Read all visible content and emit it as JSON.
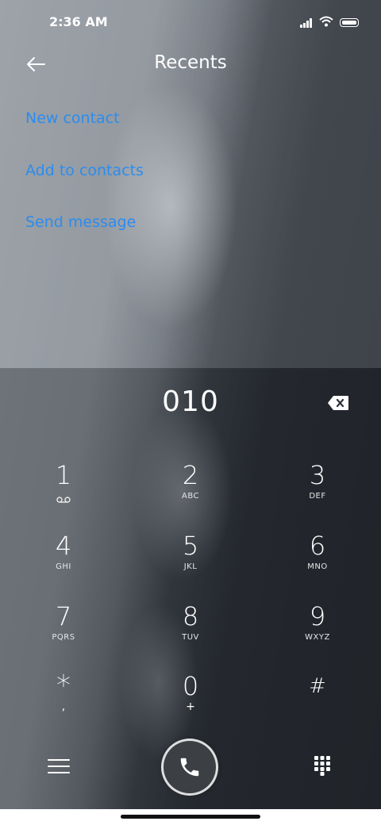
{
  "status_bar": {
    "time": "2:36 AM"
  },
  "header": {
    "title": "Recents"
  },
  "actions": [
    {
      "label": "New contact"
    },
    {
      "label": "Add to contacts"
    },
    {
      "label": "Send message"
    }
  ],
  "dialer": {
    "number": "010",
    "keys": [
      {
        "digit": "1",
        "letters": ""
      },
      {
        "digit": "2",
        "letters": "ABC"
      },
      {
        "digit": "3",
        "letters": "DEF"
      },
      {
        "digit": "4",
        "letters": "GHI"
      },
      {
        "digit": "5",
        "letters": "JKL"
      },
      {
        "digit": "6",
        "letters": "MNO"
      },
      {
        "digit": "7",
        "letters": "PQRS"
      },
      {
        "digit": "8",
        "letters": "TUV"
      },
      {
        "digit": "9",
        "letters": "WXYZ"
      },
      {
        "digit": "*",
        "letters": ","
      },
      {
        "digit": "0",
        "letters": "+"
      },
      {
        "digit": "#",
        "letters": ""
      }
    ]
  },
  "icons": {
    "back": "back-arrow-icon",
    "backspace": "backspace-icon",
    "voicemail": "voicemail-icon",
    "menu": "menu-icon",
    "call": "phone-icon",
    "dialpad": "dialpad-icon"
  },
  "colors": {
    "link": "#2b8cf0",
    "text": "#ffffff"
  }
}
